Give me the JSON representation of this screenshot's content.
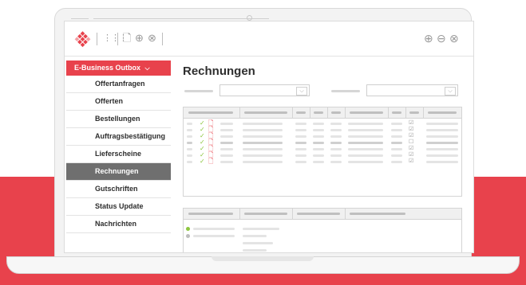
{
  "sidebar": {
    "header": "E-Business Outbox",
    "header_icon": "chevron-down-icon",
    "items": [
      {
        "label": "Offertanfragen",
        "active": false
      },
      {
        "label": "Offerten",
        "active": false
      },
      {
        "label": "Bestellungen",
        "active": false
      },
      {
        "label": "Auftragsbestätigung",
        "active": false
      },
      {
        "label": "Lieferscheine",
        "active": false
      },
      {
        "label": "Rechnungen",
        "active": true
      },
      {
        "label": "Gutschriften",
        "active": false
      },
      {
        "label": "Status Update",
        "active": false
      },
      {
        "label": "Nachrichten",
        "active": false
      }
    ]
  },
  "main": {
    "title": "Rechnungen"
  },
  "toolbar": {
    "icons_left": [
      "grid-icon",
      "document-icon",
      "add-circle-icon",
      "close-circle-icon"
    ],
    "icons_right": [
      "zoom-in-icon",
      "zoom-out-icon",
      "close-circle-icon"
    ]
  },
  "colors": {
    "accent": "#e8424c",
    "active_item": "#6f6f6f",
    "check_green": "#8dc63f"
  }
}
